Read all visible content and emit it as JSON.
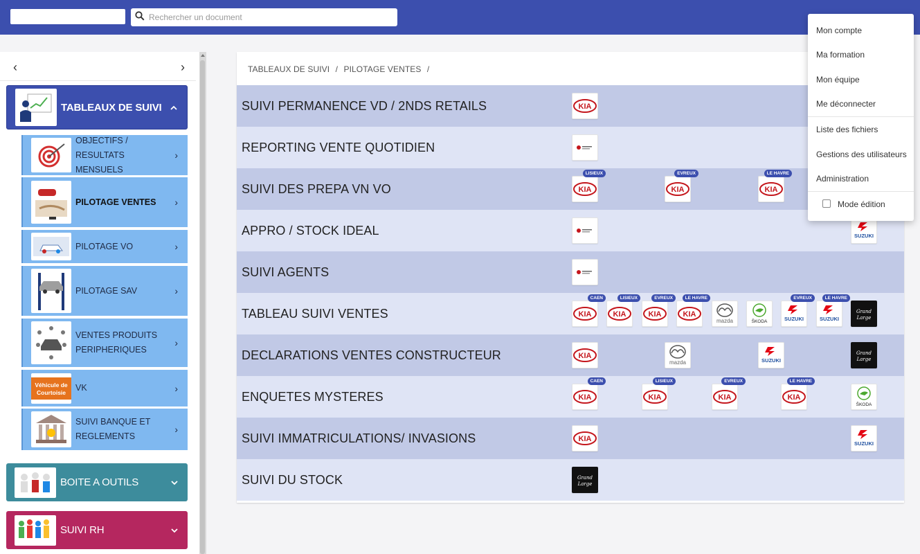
{
  "header": {
    "search_placeholder": "Rechercher un document"
  },
  "sidebar": {
    "categories": [
      {
        "label": "TABLEAUX DE SUIVI"
      },
      {
        "label": "BOITE A OUTILS"
      },
      {
        "label": "SUIVI RH"
      }
    ],
    "subitems": [
      {
        "label": "OBJECTIFS / RESULTATS MENSUELS"
      },
      {
        "label": "PILOTAGE VENTES"
      },
      {
        "label": "PILOTAGE VO"
      },
      {
        "label": "PILOTAGE SAV"
      },
      {
        "label": "VENTES PRODUITS PERIPHERIQUES"
      },
      {
        "label": "VK"
      },
      {
        "label": "SUIVI BANQUE ET REGLEMENTS"
      }
    ]
  },
  "breadcrumb": {
    "level1": "TABLEAUX DE SUIVI",
    "sep1": "/",
    "level2": "PILOTAGE VENTES",
    "sep2": "/"
  },
  "rows": [
    {
      "title": "SUIVI PERMANENCE VD / 2NDS RETAILS"
    },
    {
      "title": "REPORTING VENTE QUOTIDIEN"
    },
    {
      "title": "SUIVI DES PREPA VN VO"
    },
    {
      "title": "APPRO / STOCK IDEAL"
    },
    {
      "title": "SUIVI AGENTS"
    },
    {
      "title": "TABLEAU SUIVI VENTES"
    },
    {
      "title": "DECLARATIONS VENTES CONSTRUCTEUR"
    },
    {
      "title": "ENQUETES MYSTERES"
    },
    {
      "title": "SUIVI IMMATRICULATIONS/ INVASIONS"
    },
    {
      "title": "SUIVI DU STOCK"
    }
  ],
  "badges": {
    "lisieux": "LISIEUX",
    "evreux": "EVREUX",
    "le_havre": "LE HAVRE",
    "caen": "CAEN"
  },
  "brands": {
    "kia": "KIA",
    "mazda": "mazda",
    "skoda": "ŠKODA",
    "suzuki": "SUZUKI"
  },
  "menu": {
    "items": [
      "Mon compte",
      "Ma formation",
      "Mon équipe",
      "Me déconnecter",
      "Liste des fichiers",
      "Gestions des utilisateurs",
      "Administration",
      "Mode édition"
    ]
  },
  "colors": {
    "primary": "#3c4fae",
    "row_dark": "#c1c9e6",
    "row_light": "#dfe4f5",
    "kia_red": "#c4161c",
    "suzuki_red": "#e30613",
    "skoda_green": "#4ba82e"
  }
}
